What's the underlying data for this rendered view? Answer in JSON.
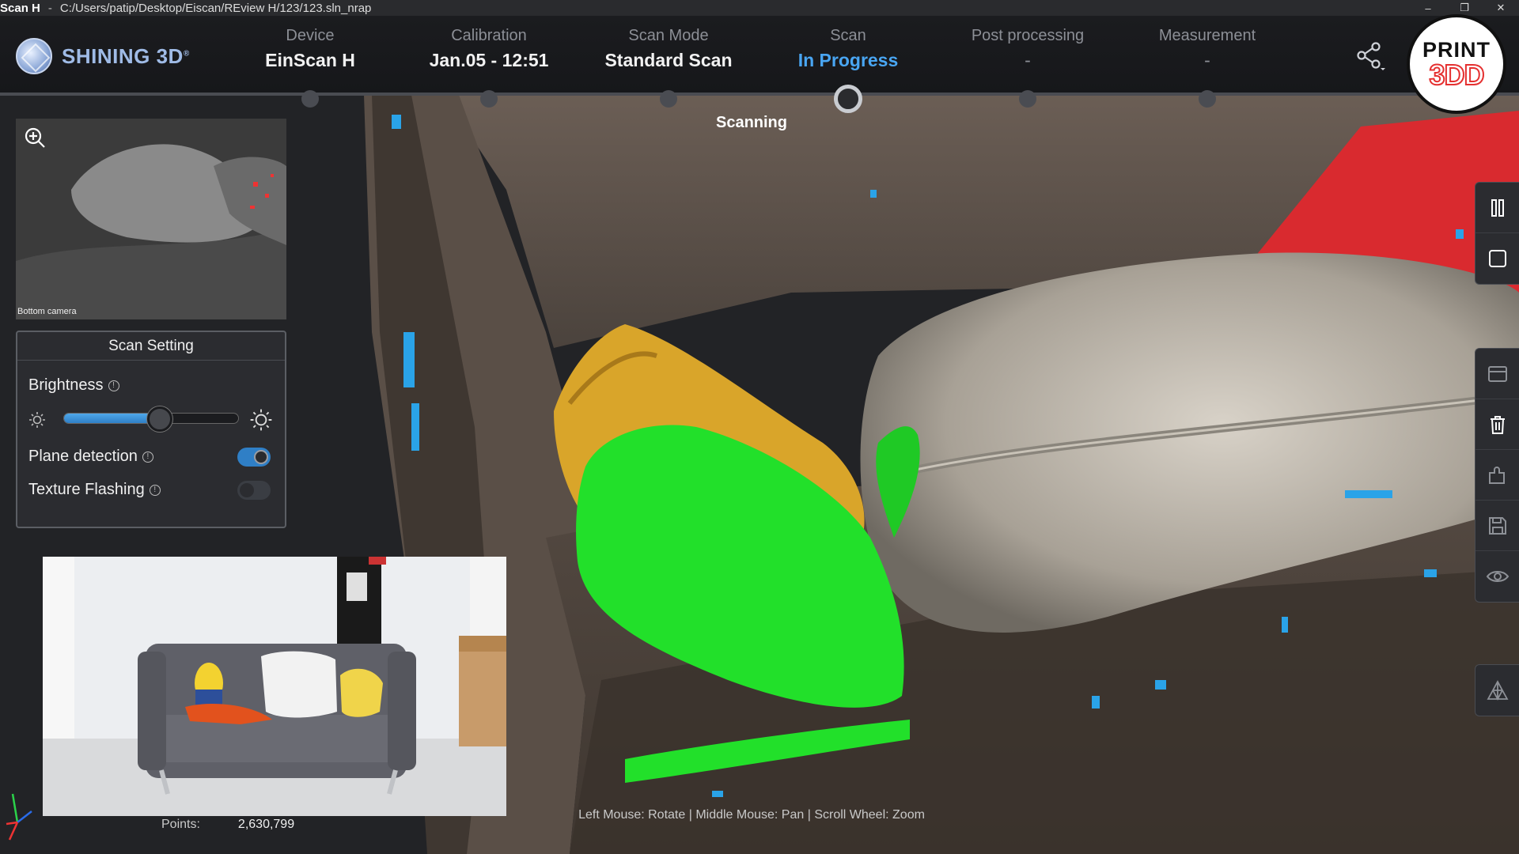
{
  "window": {
    "app_name": "Scan H",
    "path": "C:/Users/patip/Desktop/Eiscan/REview H/123/123.sln_nrap",
    "minimize": "–",
    "restore": "❐",
    "close": "✕"
  },
  "brand": {
    "name": "SHINING 3D",
    "mark": "®"
  },
  "steps": [
    {
      "label": "Device",
      "value": "EinScan H",
      "state": "done"
    },
    {
      "label": "Calibration",
      "value": "Jan.05 - 12:51",
      "state": "done"
    },
    {
      "label": "Scan Mode",
      "value": "Standard Scan",
      "state": "done"
    },
    {
      "label": "Scan",
      "value": "In Progress",
      "state": "active"
    },
    {
      "label": "Post processing",
      "value": "-",
      "state": "pending"
    },
    {
      "label": "Measurement",
      "value": "-",
      "state": "pending"
    }
  ],
  "watermark": {
    "line1": "PRINT",
    "line2": "3DD"
  },
  "viewport": {
    "status": "Scanning",
    "hint": "Left Mouse: Rotate | Middle Mouse: Pan | Scroll Wheel: Zoom"
  },
  "camera_preview": {
    "label": "Bottom camera"
  },
  "scan_setting": {
    "title": "Scan Setting",
    "brightness_label": "Brightness",
    "brightness_level": 0.55,
    "plane_detection_label": "Plane detection",
    "plane_detection": true,
    "texture_flashing_label": "Texture Flashing",
    "texture_flashing": false,
    "info_glyph": "!"
  },
  "stats": {
    "points_label": "Points:",
    "points_value": "2,630,799"
  },
  "colors": {
    "accent": "#49a6f3",
    "scan_green": "#22e02a",
    "scan_yellow": "#d9a52a",
    "scan_blue": "#2aa3e8",
    "cushion_red": "#d92a2f"
  },
  "right_toolbar": {
    "top": [
      "pause-icon",
      "stop-icon"
    ],
    "middle": [
      "panel-icon",
      "trash-icon",
      "puzzle-icon",
      "save-icon",
      "eye-icon"
    ],
    "bottom": [
      "mesh-icon"
    ]
  }
}
